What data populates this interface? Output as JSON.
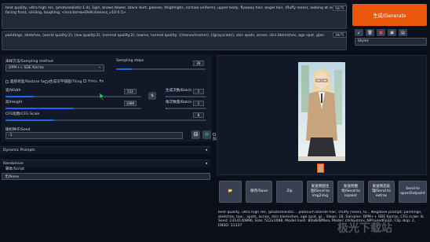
{
  "prompt": {
    "text": "best quality, ultra high res, (photorealistic:1.4), 1girl, brown blazer, black skirt, glasses, thighhighs, (school uniform), upper body, flyaway hair, angel hair, (fluffy roses), looking at viewer, facing front, smiling, laughing, <lora:koreanDollLikeness_v10:0.5>",
    "counter": "56/75"
  },
  "negative_prompt": {
    "text": "paintings, sketches, (worst quality:2), (low quality:2), (normal quality:2), lowres, normal quality, ((monochrome)), ((grayscale)), skin spots, acnes, skin blemishes, age spot, glan",
    "counter": "39/75"
  },
  "generate_button": "生成/Generate",
  "toolbar": {
    "arrow": "↙",
    "trash": "🗑",
    "red": "■",
    "paste": "▣",
    "styles_btn": "▤"
  },
  "styles_label": "Styles",
  "sampling_method": {
    "label": "采样方法/Sampling method",
    "value": "DPM++ SDE Karras"
  },
  "sampling_steps": {
    "label": "Sampling steps",
    "value": "28"
  },
  "checkboxes": {
    "restore_faces": "面部修复/Restore faces",
    "tiling": "生成可平铺图/Tiling",
    "hires_fix": "Hires. fix"
  },
  "width": {
    "label": "宽/Width",
    "value": "512"
  },
  "height": {
    "label": "高/Height",
    "value": "1088"
  },
  "swap_icon": "⇅",
  "batch_count": {
    "label": "生成次数/Batch c",
    "value": "1"
  },
  "batch_size": {
    "label": "每次数量/Batch s",
    "value": "1"
  },
  "cfg_scale": {
    "label": "CFG指数/CFG Scale",
    "value": "8"
  },
  "seed": {
    "label": "随机种子/Seed",
    "value": "-1"
  },
  "extra": {
    "label": "附加/Extra"
  },
  "dynamic_prompts": "Dynamic Prompts",
  "randomize": "Randomize",
  "script_label": "脚本/Script",
  "script_value": "无/None",
  "actions": {
    "folder": "📂",
    "save": "保存/Save",
    "zip": "Zip",
    "send_img2img": "发送到图生图/Send to img2img",
    "send_inpaint": "发送到重绘/Send to inpaint",
    "send_extras": "发送到后处理/Send to extras",
    "send_outpaint": "Send to openOutpaint"
  },
  "info_text": "best quality, ultra high res, (photorealistic... platinum blonde hair, (fluffy roses), lo... Negative prompt: paintings, sketches, low... spots, acnes, skin blemishes, age spot, gl... Steps: 28, Sampler: DPM++ SDE Karras, CFG scale: 8, Seed: 2314140896, Size: 512x1088, Model hash: 80a8d8f6ea, Model: chilloutmix_NiPrunedFp32, Clip skip: 2, ENSD: 31337",
  "watermark": "极光下载站",
  "colors": {
    "accent": "#ea580c",
    "slider": "#2563eb",
    "bg": "#0b0f19"
  }
}
